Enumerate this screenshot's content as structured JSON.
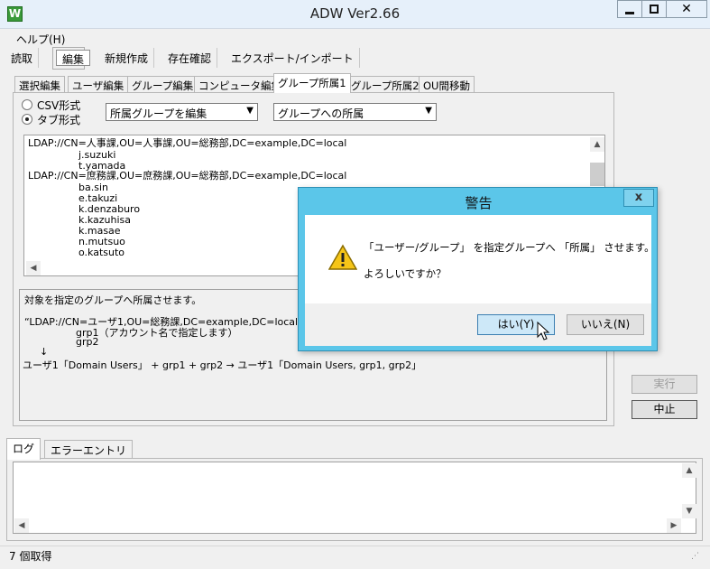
{
  "window": {
    "title": "ADW Ver2.66",
    "app_icon_letter": "W",
    "minimize": "−",
    "maximize": "□",
    "close": "✕"
  },
  "menu": {
    "help": "ヘルプ(H)"
  },
  "toolbar": [
    "読取",
    "編集",
    "新規作成",
    "存在確認",
    "エクスポート/インポート"
  ],
  "inner_tabs": [
    "選択編集",
    "ユーザ編集",
    "グループ編集",
    "コンピュータ編集",
    "グループ所属1",
    "グループ所属2",
    "OU間移動"
  ],
  "format": {
    "csv": "CSV形式",
    "tab": "タブ形式"
  },
  "selects": {
    "mode": "所属グループを編集",
    "target": "グループへの所属"
  },
  "ldap_lines": [
    "LDAP://CN=人事課,OU=人事課,OU=総務部,DC=example,DC=local",
    "j.suzuki",
    "t.yamada",
    "LDAP://CN=庶務課,OU=庶務課,OU=総務部,DC=example,DC=local",
    "ba.sin",
    "e.takuzi",
    "k.denzaburo",
    "k.kazuhisa",
    "k.masae",
    "n.mutsuo",
    "o.katsuto"
  ],
  "description": {
    "line1": "対象を指定のグループへ所属させます。",
    "line2": "“LDAP://CN=ユーザ1,OU=総務課,DC=example,DC=local”",
    "line3": "grp1（アカウント名で指定します）",
    "line4": "grp2",
    "arrow": "↓",
    "line5": "ユーザ1「Domain Users」 + grp1 + grp2 → ユーザ1「Domain Users, grp1, grp2」"
  },
  "buttons": {
    "run": "実行",
    "stop": "中止"
  },
  "log_tabs": [
    "ログ",
    "エラーエントリ"
  ],
  "status": "7 個取得",
  "dialog": {
    "title": "警告",
    "close": "x",
    "message1": "「ユーザー/グループ」 を指定グループへ 「所属」 させます。",
    "message2": "よろしいですか？",
    "yes": "はい(Y)",
    "no": "いいえ(N)"
  },
  "colors": {
    "dialog_frame": "#5bc6e9",
    "title_bg": "#e6f0fa",
    "yes_button": "#cde8f8"
  }
}
